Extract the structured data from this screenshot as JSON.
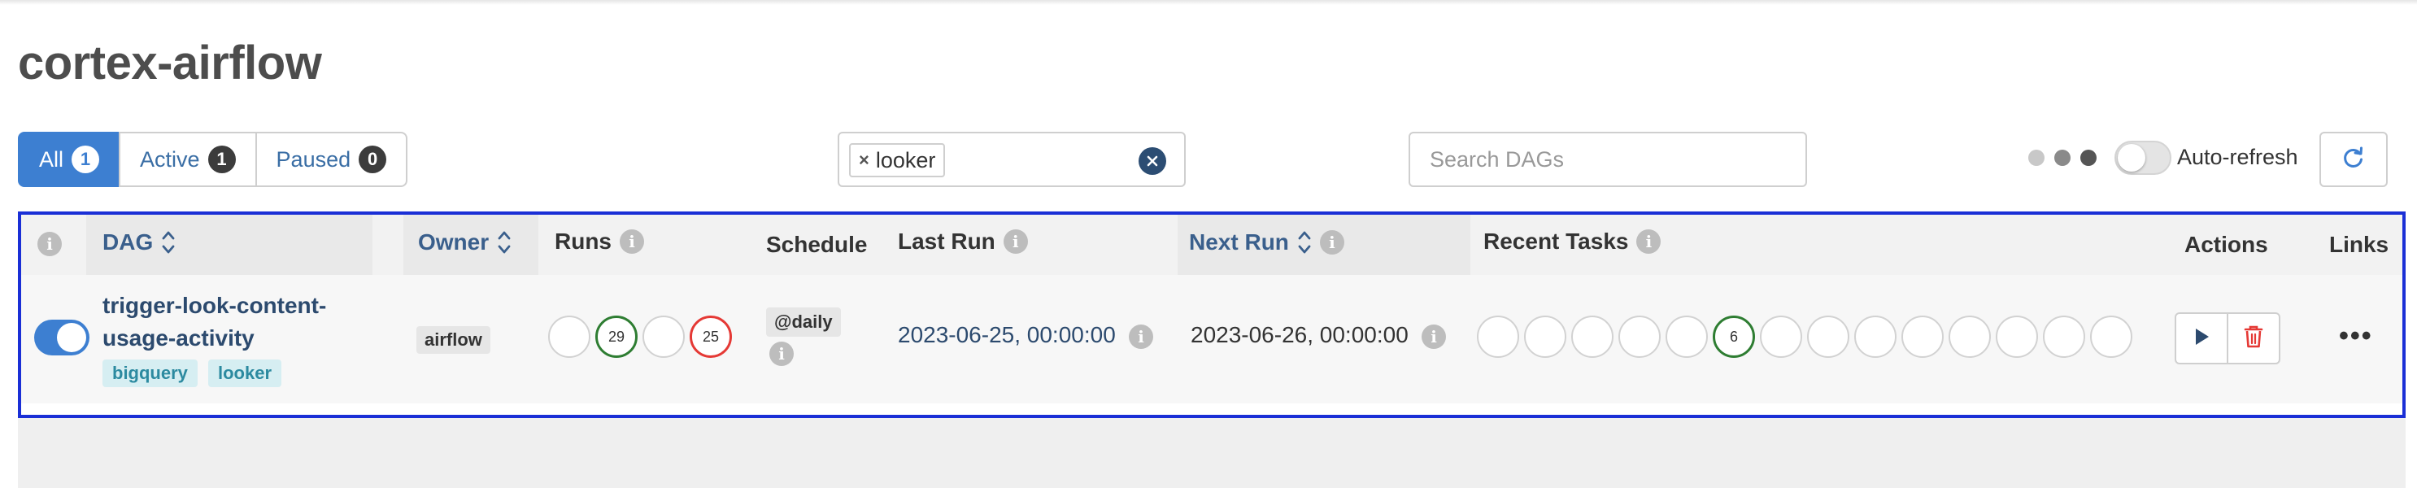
{
  "page": {
    "title": "cortex-airflow"
  },
  "filters": [
    {
      "label": "All",
      "count": "1",
      "active": true
    },
    {
      "label": "Active",
      "count": "1",
      "active": false
    },
    {
      "label": "Paused",
      "count": "0",
      "active": false
    }
  ],
  "tag_filter": {
    "selected_tag": "looker",
    "remove_glyph": "×"
  },
  "search": {
    "placeholder": "Search DAGs"
  },
  "auto_refresh": {
    "label": "Auto-refresh",
    "enabled": false
  },
  "loading_dots": {
    "colors": [
      "#c8c8c8",
      "#8a8a8a",
      "#555555"
    ]
  },
  "table": {
    "headers": {
      "dag": "DAG",
      "owner": "Owner",
      "runs": "Runs",
      "schedule": "Schedule",
      "last_run": "Last Run",
      "next_run": "Next Run",
      "recent_tasks": "Recent Tasks",
      "actions": "Actions",
      "links": "Links"
    },
    "rows": [
      {
        "dag_name": "trigger-look-content-usage-activity",
        "tags": [
          "bigquery",
          "looker"
        ],
        "owner": "airflow",
        "is_active": true,
        "runs": [
          {
            "state": "empty",
            "count": ""
          },
          {
            "state": "success",
            "count": "29"
          },
          {
            "state": "empty",
            "count": ""
          },
          {
            "state": "failed",
            "count": "25"
          }
        ],
        "schedule": "@daily",
        "last_run": "2023-06-25, 00:00:00",
        "next_run": "2023-06-26, 00:00:00",
        "recent_tasks": [
          {
            "state": "empty",
            "count": ""
          },
          {
            "state": "empty",
            "count": ""
          },
          {
            "state": "empty",
            "count": ""
          },
          {
            "state": "empty",
            "count": ""
          },
          {
            "state": "empty",
            "count": ""
          },
          {
            "state": "success",
            "count": "6"
          },
          {
            "state": "empty",
            "count": ""
          },
          {
            "state": "empty",
            "count": ""
          },
          {
            "state": "empty",
            "count": ""
          },
          {
            "state": "empty",
            "count": ""
          },
          {
            "state": "empty",
            "count": ""
          },
          {
            "state": "empty",
            "count": ""
          },
          {
            "state": "empty",
            "count": ""
          },
          {
            "state": "empty",
            "count": ""
          }
        ],
        "actions": {
          "trigger_icon": "play-icon",
          "delete_icon": "trash-icon"
        },
        "links_glyph": "•••"
      }
    ]
  },
  "colors": {
    "accent": "#3d7fd1",
    "success": "#2e7d32",
    "failed": "#e53935",
    "highlight_border": "#1a2fd6",
    "tag_bg": "#d6eef2"
  }
}
